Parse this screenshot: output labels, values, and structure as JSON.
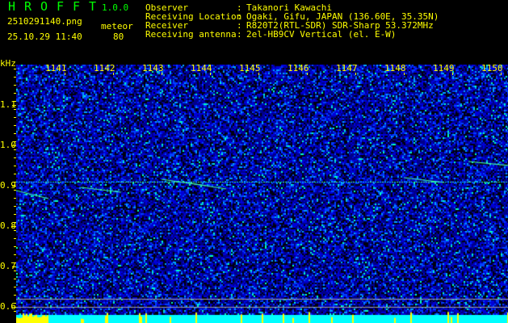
{
  "app": {
    "name_letters": [
      "H",
      "R",
      "O",
      "F",
      "F",
      "T"
    ],
    "version": "1.0.0"
  },
  "file": {
    "name": "2510291140.png",
    "datetime": "25.10.29 11:40"
  },
  "detection": {
    "label": "meteor",
    "count": "80"
  },
  "info": [
    {
      "label": "Observer",
      "value": "Takanori Kawachi"
    },
    {
      "label": "Receiving Location",
      "value": "Ogaki, Gifu, JAPAN (136.60E, 35.35N)"
    },
    {
      "label": "Receiver",
      "value": "R820T2(RTL-SDR) SDR-Sharp 53.372MHz"
    },
    {
      "label": "Receiving antenna",
      "value": "2el-HB9CV Vertical (el. E-W)"
    }
  ],
  "chart_data": {
    "type": "heatmap",
    "ylabel": "kHz",
    "yticks": [
      "1.1",
      "1.0",
      "0.9",
      "0.8",
      "0.7",
      "0.6"
    ],
    "ylim": [
      0.58,
      1.2
    ],
    "xticks": [
      "1141",
      "1142",
      "1143",
      "1144",
      "1145",
      "1146",
      "1147",
      "1148",
      "1149",
      "1150"
    ],
    "carrier_khz": 0.91,
    "colors": {
      "background": "#000000",
      "noise_low": "#0000c0",
      "noise_mid": "#0060ff",
      "noise_high": "#00ffff",
      "label": "#ffff00",
      "title": "#00ff00",
      "baseline": "#00ffff"
    }
  }
}
